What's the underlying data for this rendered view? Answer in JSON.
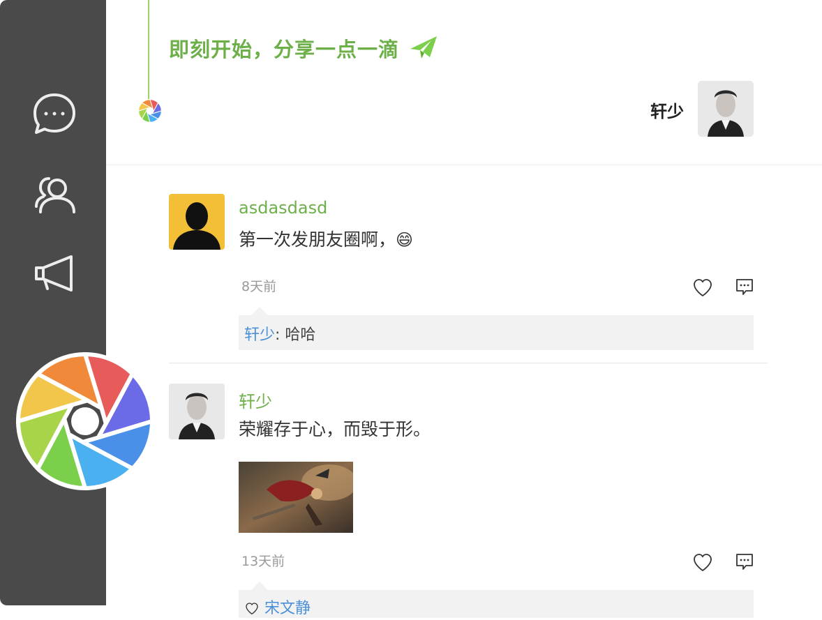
{
  "sidebar": {
    "items": [
      {
        "icon": "chat-bubble-icon"
      },
      {
        "icon": "contacts-icon"
      },
      {
        "icon": "megaphone-icon"
      }
    ],
    "logo_icon": "shutter-logo-icon"
  },
  "header": {
    "slogan": "即刻开始，分享一点一滴",
    "plane_icon": "paper-plane-icon",
    "user_name": "轩少"
  },
  "posts": [
    {
      "user": "asdasdasd",
      "text": "第一次发朋友圈啊，",
      "emoji": "😄",
      "time": "8天前",
      "comments": [
        {
          "user": "轩少",
          "sep": ": ",
          "text": "哈哈"
        }
      ]
    },
    {
      "user": "轩少",
      "text": "荣耀存于心，而毁于形。",
      "time": "13天前",
      "comments": [
        {
          "user": "宋文静",
          "sep": "",
          "text": ""
        }
      ]
    }
  ],
  "colors": {
    "sidebar_bg": "#4a4a4a",
    "accent_green": "#6db04a",
    "link_blue": "#4a90d9",
    "comment_bg": "#f2f2f2"
  }
}
